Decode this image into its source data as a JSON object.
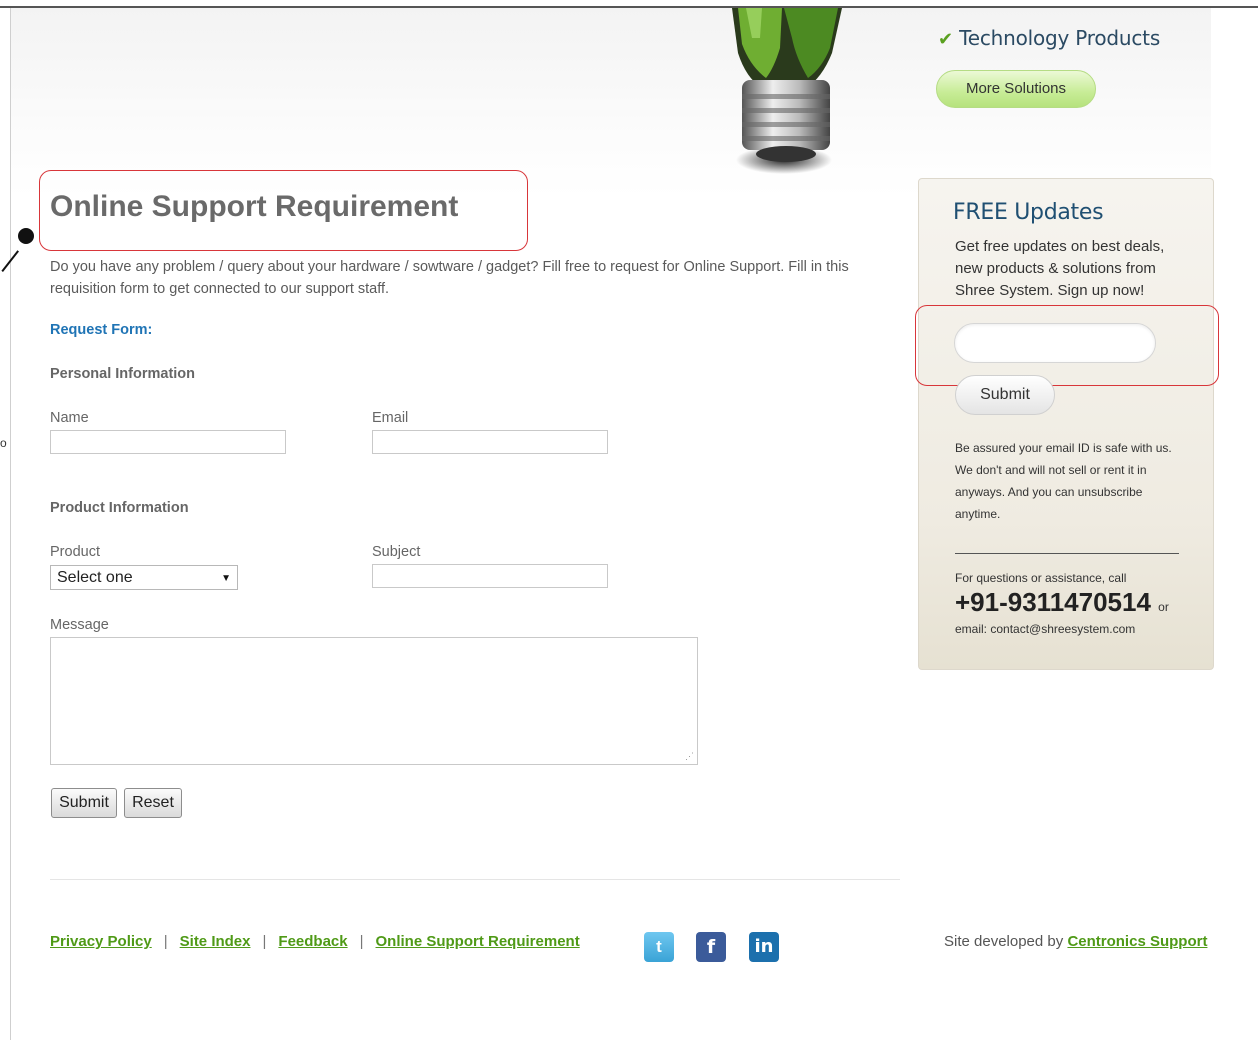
{
  "hero": {
    "solution_item": "Technology Products",
    "more_solutions_label": "More Solutions"
  },
  "page": {
    "title": "Online Support Requirement",
    "intro": "Do you have any problem / query about your hardware / sowtware / gadget? Fill free to request for Online Support. Fill in this requisition form to get connected to our support staff.",
    "request_form_heading": "Request Form:",
    "personal_info_heading": "Personal Information",
    "product_info_heading": "Product Information"
  },
  "form": {
    "name_label": "Name",
    "email_label": "Email",
    "product_label": "Product",
    "product_selected": "Select one",
    "subject_label": "Subject",
    "message_label": "Message",
    "submit_label": "Submit",
    "reset_label": "Reset"
  },
  "annotation": {
    "side_char": "o"
  },
  "updates": {
    "title": "FREE Updates",
    "description": "Get free updates on best deals, new products & solutions from Shree System. Sign up now!",
    "submit_label": "Submit",
    "privacy_note": "Be assured your email ID is safe with us. We don't and will not sell or rent it in anyways. And you can unsubscribe anytime.",
    "questions_text": "For questions or assistance, call",
    "phone": "+91-9311470514",
    "or_text": "or",
    "email_line": "email: contact@shreesystem.com"
  },
  "footer": {
    "links": [
      "Privacy Policy",
      "Site Index",
      "Feedback",
      "Online Support Requirement"
    ],
    "social_icons": [
      "twitter-icon",
      "facebook-icon",
      "linkedin-icon"
    ],
    "developed_by_text": "Site developed by",
    "developer_link": "Centronics Support"
  },
  "colors": {
    "link_green": "#4f9a17",
    "heading_blue": "#1f74b5",
    "annotation_red": "#d8363a"
  }
}
